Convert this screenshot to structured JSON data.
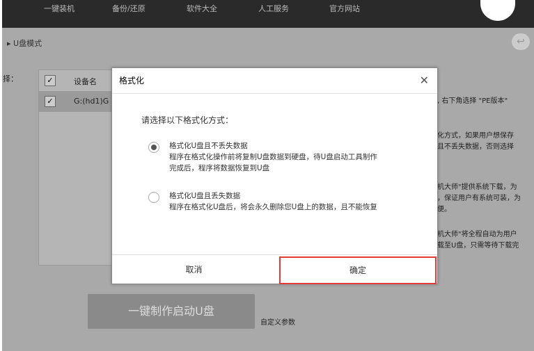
{
  "nav": [
    "一键装机",
    "备份/还原",
    "软件大全",
    "人工服务",
    "官方网站"
  ],
  "breadcrumb": "U盘模式",
  "select_label": "择：",
  "table": {
    "header": "设备名",
    "rows": [
      "G:(hd1)G"
    ]
  },
  "side_text": [
    ", 右下角选择 \"PE版本\"",
    "化方式，如果用户想保存",
    "且不丢失数据，否则选择",
    "机大师\"提供系统下载，为",
    "，保证用户有系统可装，为",
    "便。",
    "机大师\"将全程自动为用户",
    "载至U盘，只需等待下载完"
  ],
  "dialog": {
    "title": "格式化",
    "prompt": "请选择以下格式化方式：",
    "options": [
      {
        "title": "格式化U盘且不丢失数据",
        "desc1": "程序在格式化操作前将复制U盘数据到硬盘，待U盘启动工具制作",
        "desc2": "完成后，程序将数据恢复到U盘",
        "selected": true
      },
      {
        "title": "格式化U盘且丢失数据",
        "desc1": "程序在格式化U盘后，将会永久删除您U盘上的数据，且不能恢复",
        "selected": false
      }
    ],
    "cancel": "取消",
    "ok": "确定"
  },
  "make_button": "一键制作启动U盘",
  "custom_params": "自定义参数",
  "highlight_color": "#e53935"
}
